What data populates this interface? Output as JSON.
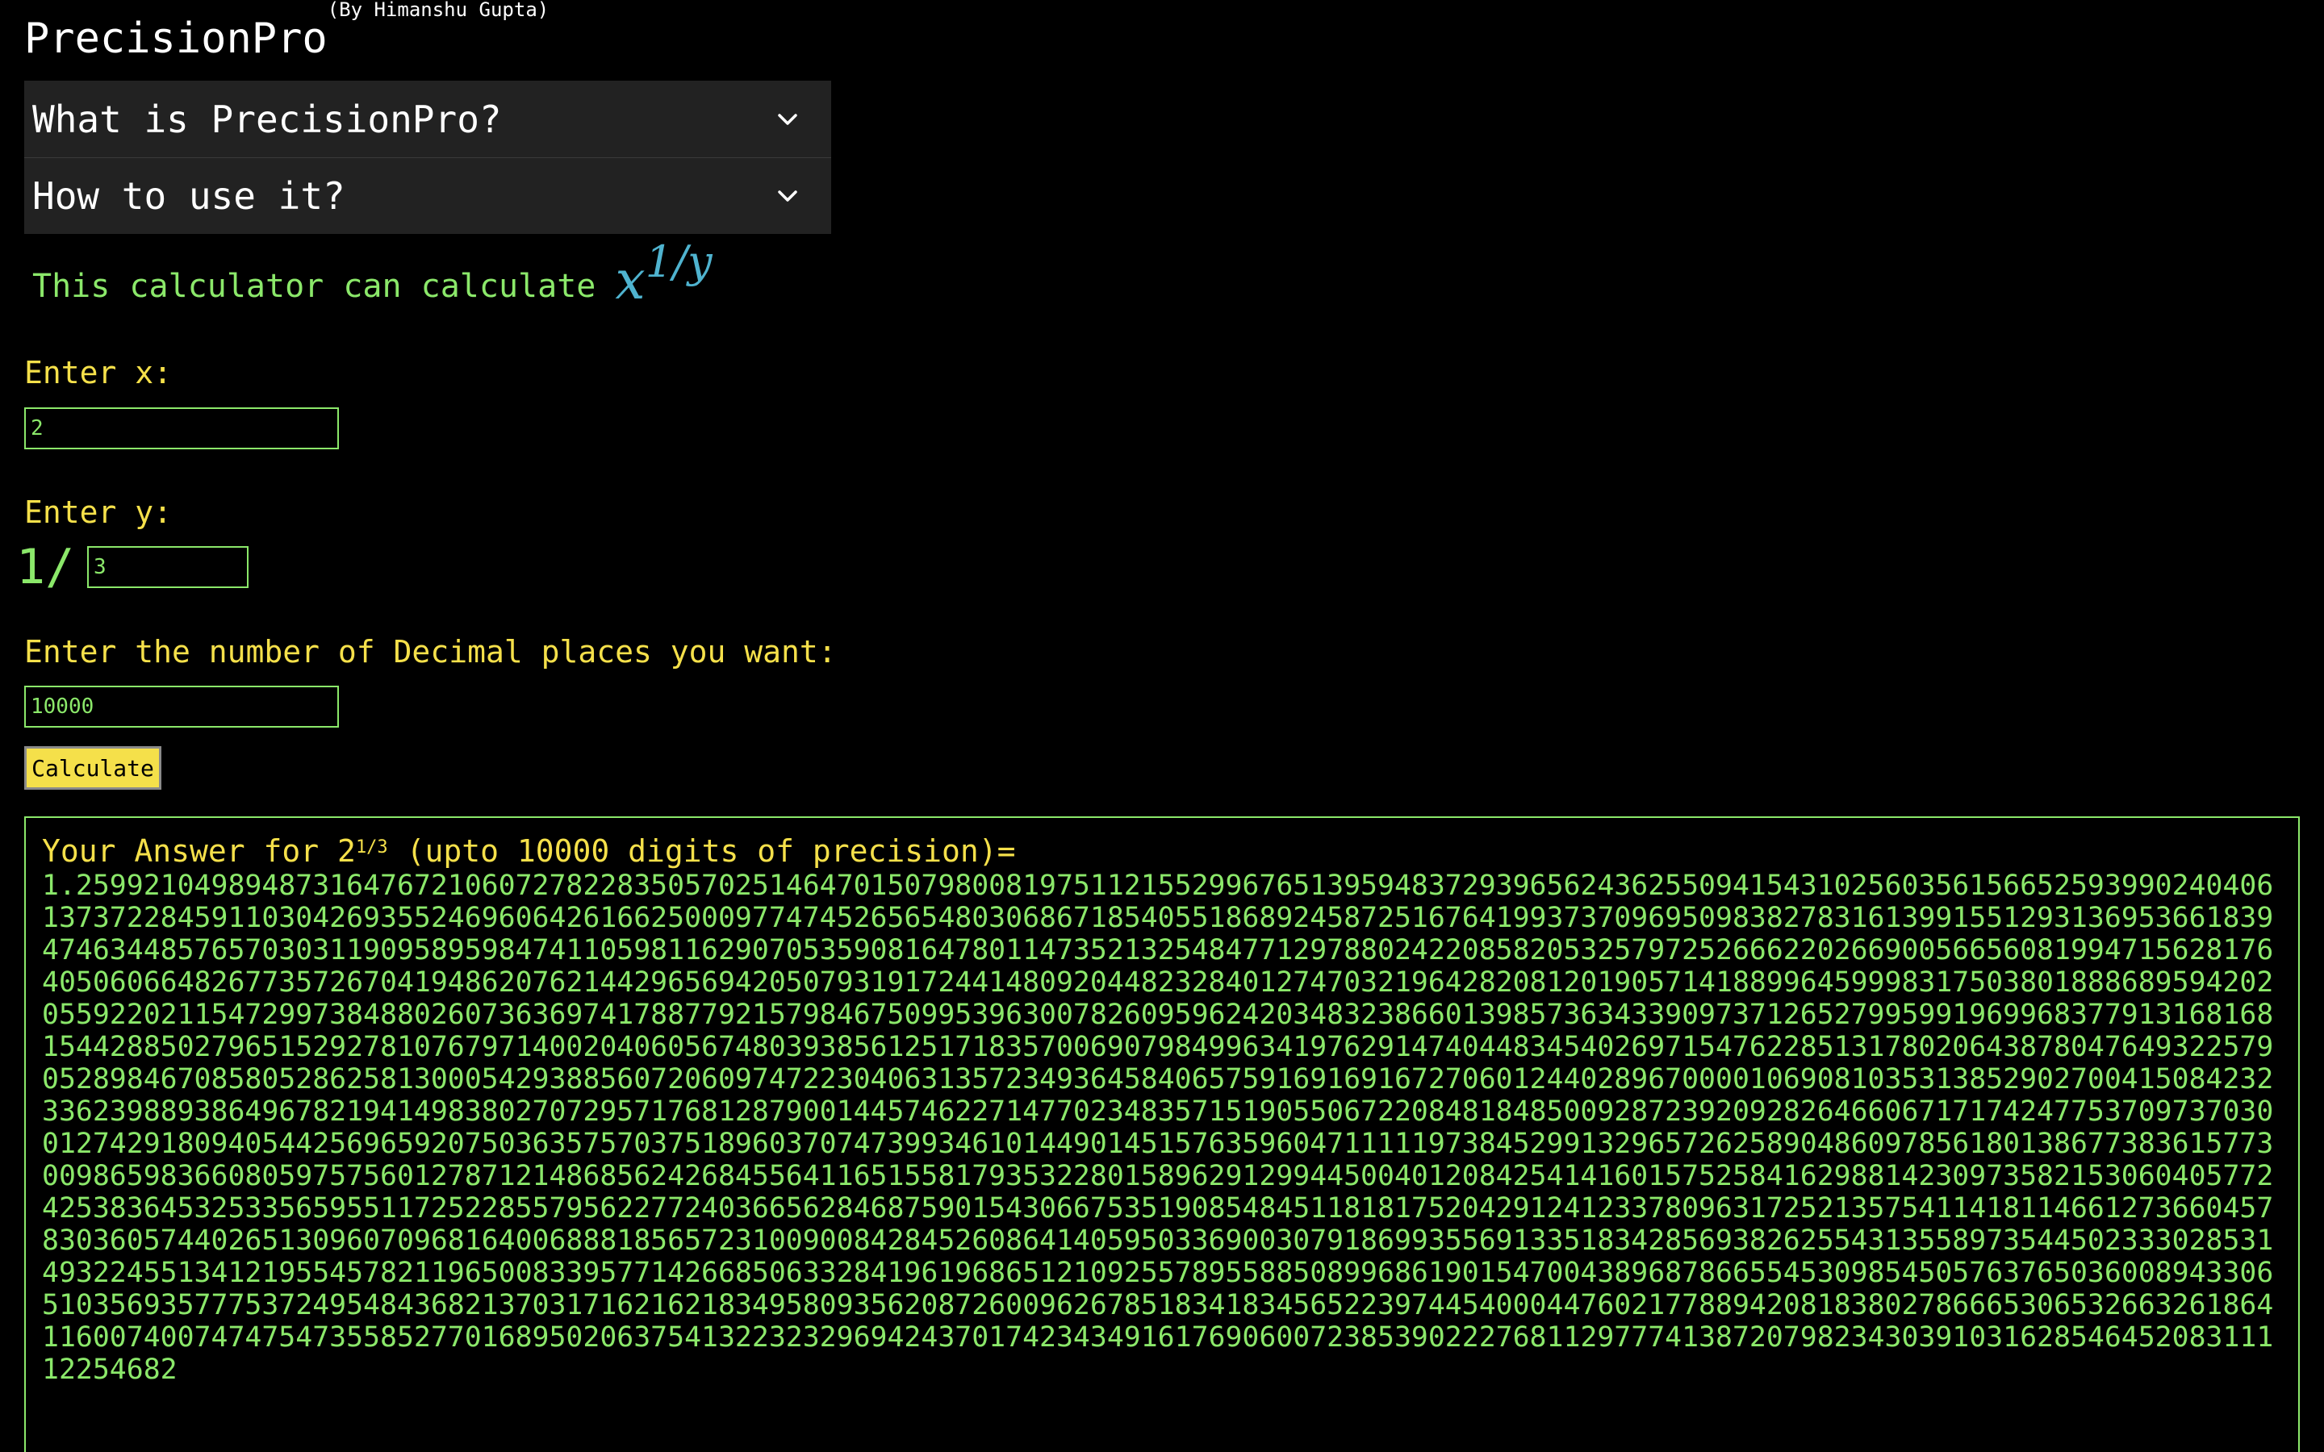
{
  "header": {
    "title": "PrecisionPro",
    "byline": "(By Himanshu Gupta)"
  },
  "accordion": {
    "items": [
      {
        "label": "What is PrecisionPro?",
        "icon": "chevron-down-icon"
      },
      {
        "label": "How to use it?",
        "icon": "chevron-down-icon"
      }
    ]
  },
  "intro": {
    "text": "This calculator can calculate",
    "formula_base": "x",
    "formula_exp": "1/y"
  },
  "form": {
    "x_label": "Enter x:",
    "x_value": "2",
    "y_label": "Enter y:",
    "y_prefix": "1/",
    "y_value": "3",
    "decimals_label": "Enter the number of Decimal places you want:",
    "decimals_value": "10000",
    "calculate_label": "Calculate"
  },
  "result": {
    "prefix": "Your Answer for ",
    "base": "2",
    "exponent": "1/3",
    "suffix": " (upto 10000 digits of precision)=",
    "digits": "1.259921049894873164767210607278228350570251464701507980081975112155299676513959483729396562436255094154310256035615665259399024040613737228459110304269355246960642616625000977474526565480306867185405518689245872516764199373709695098382783161399155129313695366183947463448576570303119095895984741105981162907053590816478011473521325484771297880242208582053257972526662202669005665608199471562817640506066482677357267041948620762144296569420507931917244148092044823284012747032196428208120190571418899645999831750380188868959420205592202115472997384880260736369741788779215798467509953963007826095962420348323866013985736343390973712652799599196996837791316816815442885027965152927810767971400204060567480393856125171835700690798499634197629147404483454026971547622851317802064387804764932257905289846708580528625813000542938856072060974722304063135723493645840657591691691672706012440289670000106908103531385290270041508423233623988938649678219414983802707295717681287900144574622714770234835715190550672208481848500928723920928264660671717424775370973703001274291809405442569659207503635757037518960370747399346101449014515763596047111119738452991329657262589048609785618013867738361577300986598366080597575601278712148685624268455641165155817935322801589629129944500401208425414160157525841629881423097358215306040577242538364532533565955117252285579562277240366562846875901543066753519085484511818175204291241233780963172521357541141811466127366045783036057440265130960709681640068881856572310090084284526086414059503369003079186993556913351834285693826255431355897354450233302853149322455134121955457821196500833957714266850633284196196865121092557895588508996861901547004389687866554530985450576376503600894330651035693577753724954843682137031716216218349580935620872600962678518341834565223974454000447602177889420818380278666530653266326186411600740074747547355852770168950206375413223232969424370174234349161769060072385390222768112977741387207982343039103162854645208311112254682"
  }
}
